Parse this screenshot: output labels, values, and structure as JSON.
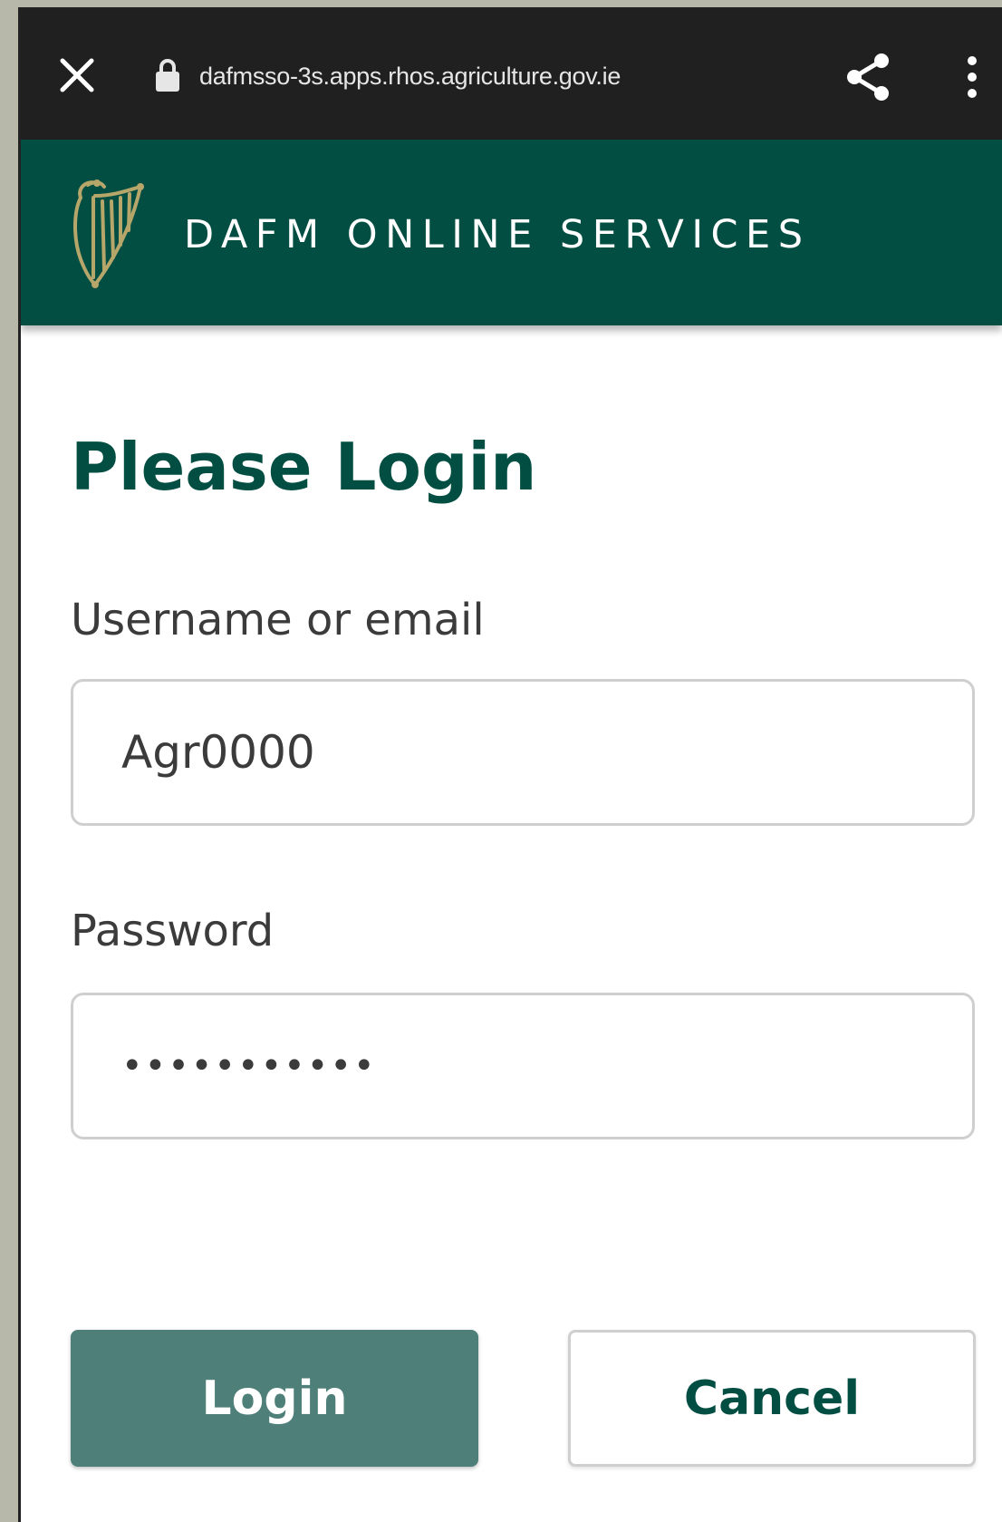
{
  "browser": {
    "url": "dafmsso-3s.apps.rhos.agriculture.gov.ie",
    "icons": {
      "close": "close-icon",
      "lock": "lock-icon",
      "share": "share-icon",
      "more": "more-vert-icon"
    }
  },
  "header": {
    "title": "DAFM ONLINE SERVICES",
    "background_color": "#024e42",
    "logo": "harp-icon"
  },
  "form": {
    "title": "Please Login",
    "username_label": "Username or email",
    "username_value": "Agr0000",
    "password_label": "Password",
    "password_value": "•••••••••••",
    "login_label": "Login",
    "cancel_label": "Cancel"
  },
  "colors": {
    "primary": "#024e42",
    "login_button": "#4e7f79",
    "browser_bar": "#202020"
  }
}
